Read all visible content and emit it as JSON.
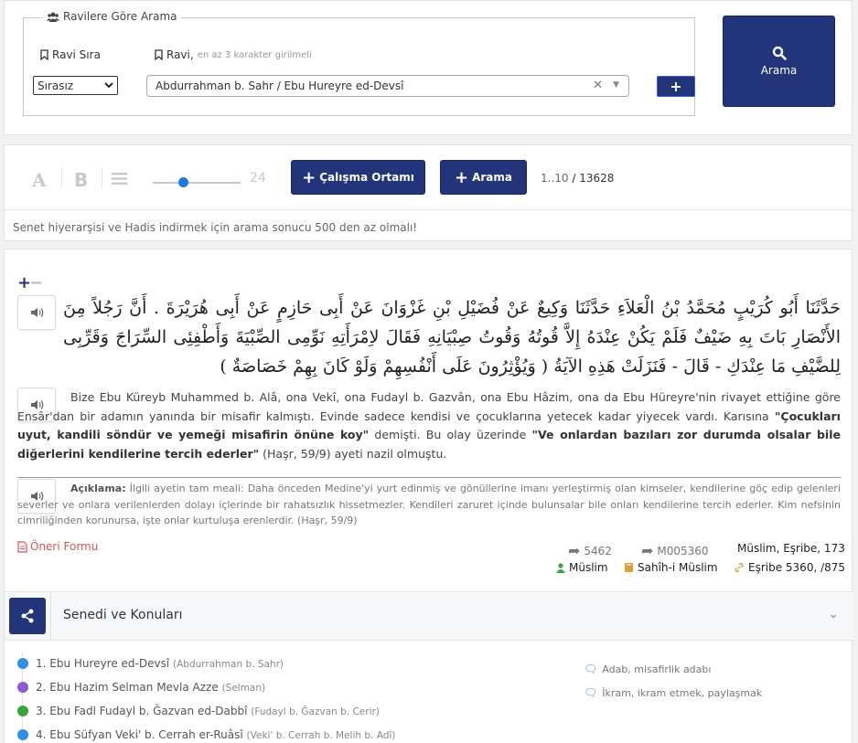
{
  "search_panel": {
    "legend": "Ravilere Göre Arama",
    "ravi_sira_label": "Ravi Sıra",
    "ravi_label": "Ravi,",
    "ravi_hint": "en az 3 karakter girilmeli",
    "order_select_value": "Sırasız",
    "ravi_selected": "Abdurrahman b. Sahr / Ebu Hureyre ed-Devsî",
    "add_button_label": "+",
    "search_button_label": "Arama",
    "icons": {
      "legend": "users-icon",
      "label": "bookmark-icon",
      "search": "search-icon"
    }
  },
  "toolbar": {
    "font_a": "A",
    "font_b": "B",
    "font_size_value": "24",
    "font_size_fraction": 0.35,
    "work_env_label": "Çalışma Ortamı",
    "search_label": "Arama",
    "range_text": "1..10",
    "total_text": "/ 13628",
    "warning": "Senet hiyerarşisi ve Hadis indirmek için arama sonucu 500 den az olmalı!"
  },
  "hadith": {
    "arabic": "حَدَّثَنَا أَبُو كُرَيْبٍ مُحَمَّدُ بْنُ الْعَلاَءِ حَدَّثَنَا وَكِيعٌ عَنْ فُضَيْلِ بْنِ غَزْوَانَ عَنْ أَبِى حَازِمٍ عَنْ أَبِى هُرَيْرَةَ . أَنَّ رَجُلاً مِنَ الأَنْصَارِ بَاتَ بِهِ ضَيْفٌ فَلَمْ يَكُنْ عِنْدَهُ إِلاَّ قُوتُهُ وَقُوتُ صِبْيَانِهِ فَقَالَ لاِمْرَأَتِهِ نَوِّمِى الصِّبْيَةَ وَأَطْفِئِى السِّرَاجَ وَقَرِّبِى لِلضَّيْفِ مَا عِنْدَكِ - قَالَ - فَنَزَلَتْ هَذِهِ الآيَةُ ( وَيُؤْثِرُونَ عَلَى أَنْفُسِهِمْ وَلَوْ كَانَ بِهِمْ خَصَاصَةٌ )",
    "translation_part1": "Bize Ebu Küreyb Muhammed b. Alâ, ona Vekî, ona Fudayl b. Gazvân, ona Ebu Hâzim, ona da Ebu Hüreyre'nin rivayet ettiğine göre Ensâr'dan bir adamın yanında bir misafir kalmıştı. Evinde sadece kendisi ve çocuklarına yetecek kadar yiyecek vardı. Karısına",
    "translation_bold1": "\"Çocukları uyut, kandili söndür ve yemeği misafirin önüne koy\"",
    "translation_part2": "demişti. Bu olay üzerinde",
    "translation_bold2": "\"Ve onlardan bazıları zor durumda olsalar bile diğerlerini kendilerine tercih ederler\"",
    "translation_part3": "(Haşr, 59/9) ayeti nazil olmuştu.",
    "explanation_key": "Açıklama:",
    "explanation": "İlgili ayetin tam meali: Daha önceden Medine'yi yurt edinmiş ve gönüllerine imanı yerleştirmiş olan kimseler, kendilerine göç edip gelenleri severler ve onlara verilenlerden dolayı içlerinde bir rahatsızlık hissetmezler. Kendileri zaruret içinde bulunsalar bile onları kendilerine tercih ederler. Kim nefsinin cimriliğinden korunursa, işte onlar kurtuluşa erenlerdir. (Haşr, 59/9)",
    "oneri_label": "Öneri Formu",
    "share_count": "5462",
    "ref_code": "M005360",
    "source_ref": "Müslim, Eşribe, 173",
    "author": "Müslim",
    "book": "Sahîh-i Müslim",
    "chapter_ref": "Eşribe 5360, /875"
  },
  "accordion": {
    "title": "Senedi ve Konuları"
  },
  "chain": [
    {
      "name": "1. Ebu Hureyre ed-Devsî",
      "sub": "(Abdurrahman b. Sahr)",
      "color": "#2e8ee8"
    },
    {
      "name": "2. Ebu Hazim Selman Mevla Azze",
      "sub": "(Selman)",
      "color": "#8d5ad6"
    },
    {
      "name": "3. Ebu Fadl Fudayl b. Ğazvan ed-Dabbî",
      "sub": "(Fudayl b. Ğazvan b. Cerir)",
      "color": "#3aa63a"
    },
    {
      "name": "4. Ebu Süfyan Veki' b. Cerrah er-Ruâsî",
      "sub": "(Veki' b. Cerrah b. Melih b. Adî)",
      "color": "#2e8ee8"
    }
  ],
  "topics": [
    "Adab, misafirlik adabı",
    "İkram, ikram etmek, paylaşmak"
  ]
}
